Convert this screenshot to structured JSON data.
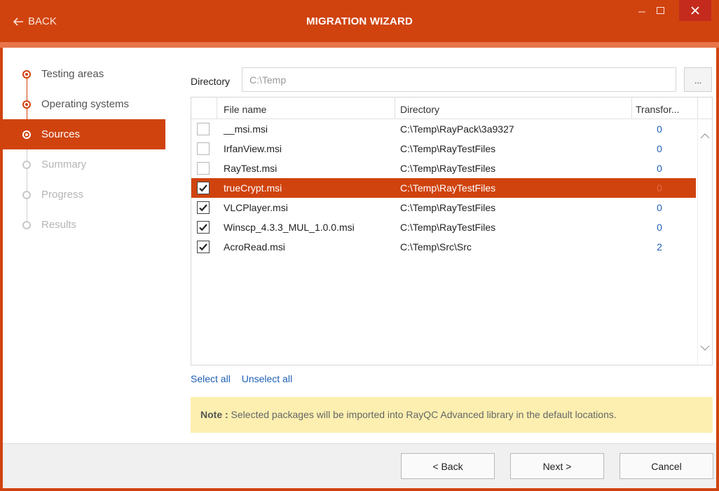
{
  "window": {
    "back_label": "BACK",
    "title": "MIGRATION WIZARD",
    "accent_color": "#d0430f"
  },
  "steps": [
    {
      "label": "Testing areas",
      "state": "done"
    },
    {
      "label": "Operating systems",
      "state": "done"
    },
    {
      "label": "Sources",
      "state": "active"
    },
    {
      "label": "Summary",
      "state": "pending"
    },
    {
      "label": "Progress",
      "state": "pending"
    },
    {
      "label": "Results",
      "state": "pending"
    }
  ],
  "directory": {
    "label": "Directory",
    "value": "C:\\Temp",
    "browse_label": "..."
  },
  "grid": {
    "columns": [
      "File name",
      "Directory",
      "Transfor..."
    ],
    "rows": [
      {
        "checked": false,
        "file": "__msi.msi",
        "dir": "C:\\Temp\\RayPack\\3a9327",
        "transforms": "0",
        "selected": false
      },
      {
        "checked": false,
        "file": "IrfanView.msi",
        "dir": "C:\\Temp\\RayTestFiles",
        "transforms": "0",
        "selected": false
      },
      {
        "checked": false,
        "file": "RayTest.msi",
        "dir": "C:\\Temp\\RayTestFiles",
        "transforms": "0",
        "selected": false
      },
      {
        "checked": true,
        "file": "trueCrypt.msi",
        "dir": "C:\\Temp\\RayTestFiles",
        "transforms": "0",
        "selected": true
      },
      {
        "checked": true,
        "file": "VLCPlayer.msi",
        "dir": "C:\\Temp\\RayTestFiles",
        "transforms": "0",
        "selected": false
      },
      {
        "checked": true,
        "file": "Winscp_4.3.3_MUL_1.0.0.msi",
        "dir": "C:\\Temp\\RayTestFiles",
        "transforms": "0",
        "selected": false
      },
      {
        "checked": true,
        "file": "AcroRead.msi",
        "dir": "C:\\Temp\\Src\\Src",
        "transforms": "2",
        "selected": false
      }
    ]
  },
  "links": {
    "select_all": "Select all",
    "unselect_all": "Unselect all"
  },
  "note": {
    "prefix": "Note :",
    "text": " Selected packages will be imported into RayQC Advanced library in the default locations."
  },
  "footer": {
    "back": "< Back",
    "next": "Next >",
    "cancel": "Cancel"
  }
}
